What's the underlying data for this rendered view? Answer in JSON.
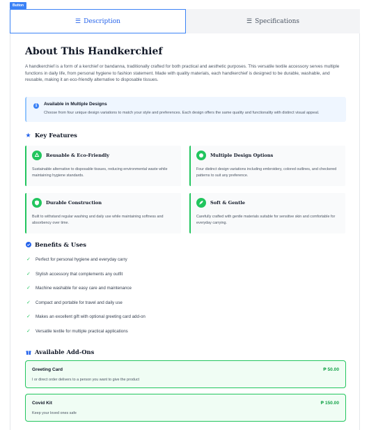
{
  "badge": "Button",
  "tabs": [
    {
      "label": "Description",
      "icon": "list-icon",
      "active": true
    },
    {
      "label": "Specifications",
      "icon": "list-icon",
      "active": false
    }
  ],
  "about": {
    "title": "About This Handkerchief",
    "intro": "A handkerchief is a form of a kerchief or bandanna, traditionally crafted for both practical and aesthetic purposes. This versatile textile accessory serves multiple functions in daily life, from personal hygiene to fashion statement. Made with quality materials, each handkerchief is designed to be durable, washable, and reusable, making it an eco-friendly alternative to disposable tissues."
  },
  "info": {
    "title": "Available in Multiple Designs",
    "text": "Choose from four unique design variations to match your style and preferences. Each design offers the same quality and functionality with distinct visual appeal."
  },
  "features": {
    "heading": "Key Features",
    "items": [
      {
        "title": "Reusable & Eco-Friendly",
        "text": "Sustainable alternative to disposable tissues, reducing environmental waste while maintaining hygiene standards.",
        "icon": "recycle-icon"
      },
      {
        "title": "Multiple Design Options",
        "text": "Four distinct design variations including embroidery, colored outlines, and checkered patterns to suit any preference.",
        "icon": "palette-icon"
      },
      {
        "title": "Durable Construction",
        "text": "Built to withstand regular washing and daily use while maintaining softness and absorbency over time.",
        "icon": "shield-icon"
      },
      {
        "title": "Soft & Gentle",
        "text": "Carefully crafted with gentle materials suitable for sensitive skin and comfortable for everyday carrying.",
        "icon": "feather-icon"
      }
    ]
  },
  "benefits": {
    "heading": "Benefits & Uses",
    "items": [
      "Perfect for personal hygiene and everyday carry",
      "Stylish accessory that complements any outfit",
      "Machine washable for easy care and maintenance",
      "Compact and portable for travel and daily use",
      "Makes an excellent gift with optional greeting card add-on",
      "Versatile textile for multiple practical applications"
    ]
  },
  "addons": {
    "heading": "Available Add-Ons",
    "items": [
      {
        "name": "Greeting Card",
        "desc": "I or direct order delivers to a person you want to give the product",
        "price": "₱ 50.00"
      },
      {
        "name": "Covid Kit",
        "desc": "Keep your loved ones safe",
        "price": "₱ 150.00"
      }
    ]
  },
  "colors": {
    "accent": "#2563eb",
    "success": "#22c55e",
    "info_bg": "#eff6ff",
    "addon_bg": "#f0fdf4"
  }
}
